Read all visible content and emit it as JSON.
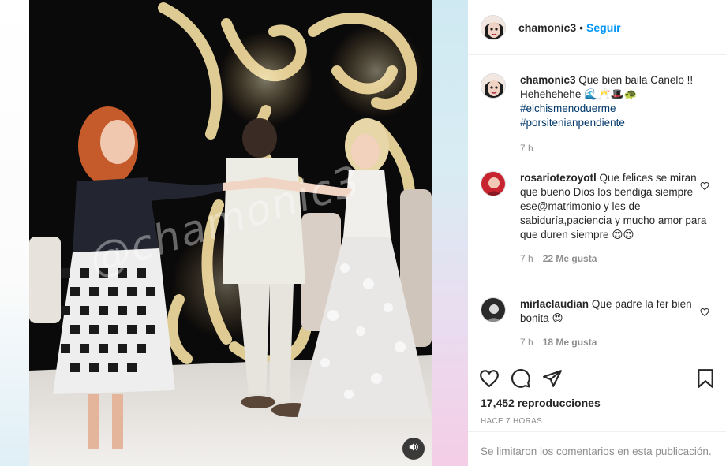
{
  "post": {
    "username": "chamonic3",
    "separator": "•",
    "follow_label": "Seguir",
    "watermark": "@chamonic3"
  },
  "caption": {
    "username": "chamonic3",
    "text": "Que bien baila Canelo !! Hehehehehe 🌊🥂🎩🐢",
    "hashtags": [
      "#elchismenoduerme",
      "#porsitenianpendiente"
    ],
    "time": "7 h"
  },
  "comments": [
    {
      "username": "rosariotezoyotl",
      "text": "Que felices se miran que bueno Dios los bendiga siempre ese@matrimonio y les de sabiduría,paciencia y mucho amor para que duren siempre 😍😍",
      "time": "7 h",
      "likes": "22 Me gusta"
    },
    {
      "username": "mirlaclaudian",
      "text": "Que padre la fer bien bonita 😍",
      "time": "7 h",
      "likes": "18 Me gusta"
    }
  ],
  "stats": {
    "views": "17,452 reproducciones",
    "posted": "HACE 7 HORAS"
  },
  "footer": {
    "comments_limited": "Se limitaron los comentarios en esta publicación."
  },
  "icons": [
    "heart-icon",
    "comment-icon",
    "share-icon",
    "bookmark-icon",
    "speaker-icon"
  ],
  "colors": {
    "follow": "#0095f6",
    "hashtag": "#00376b",
    "muted": "#8e8e8e",
    "text": "#262626"
  }
}
